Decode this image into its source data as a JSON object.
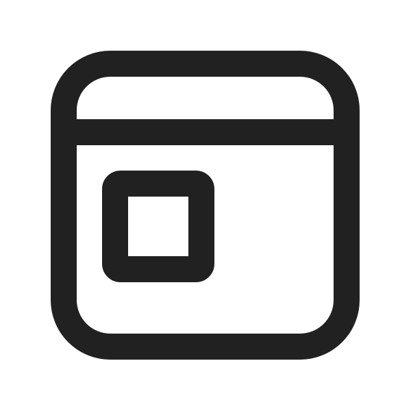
{
  "icon": {
    "name": "browser-window-icon",
    "stroke_color": "#212121",
    "background_color": "#ffffff"
  }
}
